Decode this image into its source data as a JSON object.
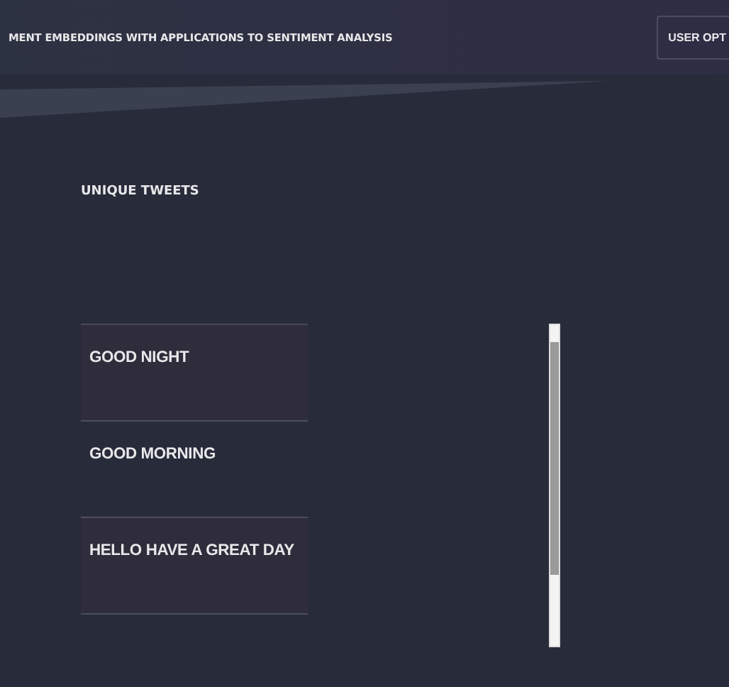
{
  "header": {
    "title": "MENT EMBEDDINGS WITH APPLICATIONS TO SENTIMENT ANALYSIS",
    "button": "USER OPT"
  },
  "section": {
    "title": "UNIQUE TWEETS"
  },
  "tweets": [
    "GOOD NIGHT",
    "GOOD MORNING",
    "HELLO HAVE A GREAT DAY"
  ]
}
